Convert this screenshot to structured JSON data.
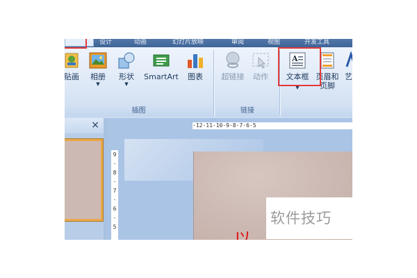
{
  "ribbon_tabs": [
    "设计",
    "动画",
    "幻灯片放映",
    "审阅",
    "视图",
    "开发工具"
  ],
  "groups": {
    "illustrations": {
      "label": "插图",
      "buttons": {
        "clipart": "贴画",
        "album": "相册",
        "shapes": "形状",
        "smartart": "SmartArt",
        "chart": "图表"
      }
    },
    "links": {
      "label": "链接",
      "buttons": {
        "hyperlink": "超链接",
        "action": "动作"
      }
    },
    "text": {
      "buttons": {
        "textbox": "文本框",
        "header_footer_1": "页眉和",
        "header_footer_2": "页脚",
        "wordart": "艺术"
      }
    }
  },
  "panel": {
    "close": "×"
  },
  "hruler_text": "·12·11·10·9·8·7·6·5",
  "vruler_marks": [
    "9",
    "8",
    "7",
    "6",
    "5"
  ],
  "slide_text": "以",
  "watermark": "软件技巧",
  "colors": {
    "highlight": "#e23a3a",
    "accent": "#3e6497"
  }
}
